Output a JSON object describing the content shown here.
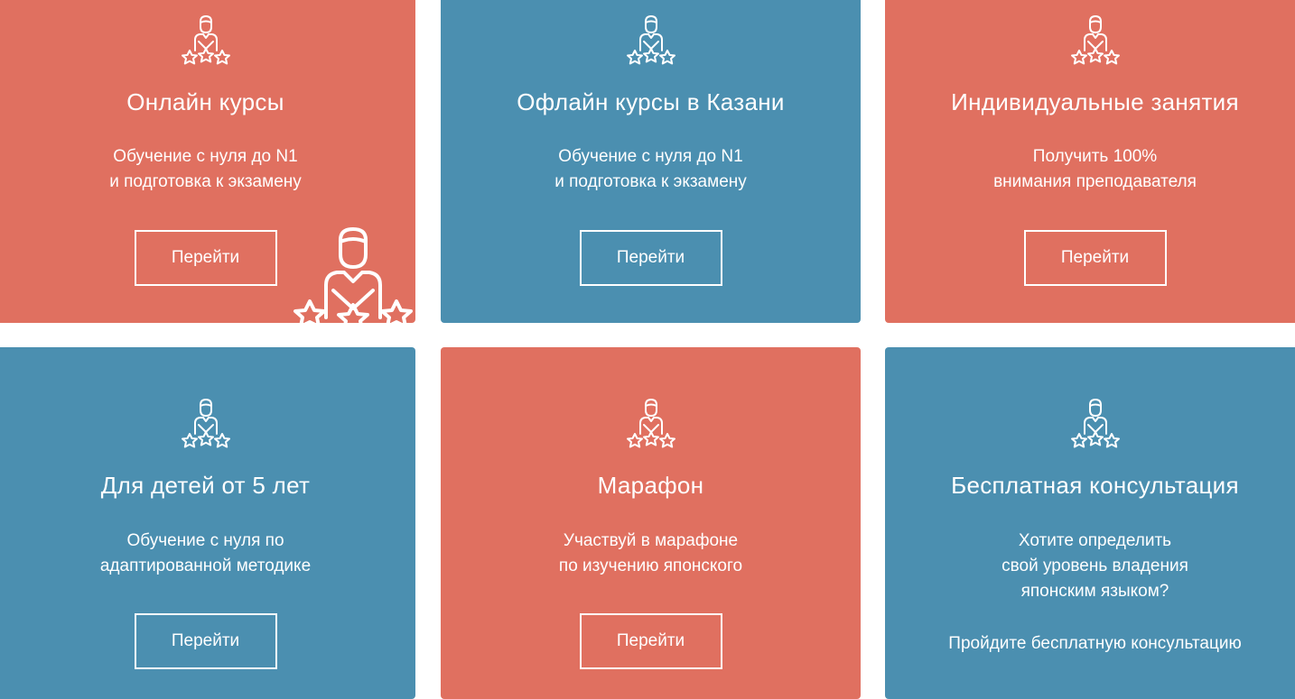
{
  "cards": [
    {
      "title": "Онлайн курсы",
      "desc_line1": "Обучение с нуля до N1",
      "desc_line2": "и подготовка к экзамену",
      "button": "Перейти",
      "color": "#e07060"
    },
    {
      "title": "Офлайн курсы в Казани",
      "desc_line1": "Обучение с нуля до N1",
      "desc_line2": "и подготовка к экзамену",
      "button": "Перейти",
      "color": "#4b8fb0"
    },
    {
      "title": "Индивидуальные занятия",
      "desc_line1": "Получить 100%",
      "desc_line2": "внимания преподавателя",
      "button": "Перейти",
      "color": "#e07060"
    },
    {
      "title": "Для детей от 5 лет",
      "desc_line1": "Обучение с нуля по",
      "desc_line2": "адаптированной методике",
      "button": "Перейти",
      "color": "#4b8fb0"
    },
    {
      "title": "Марафон",
      "desc_line1": "Участвуй в марафоне",
      "desc_line2": "по изучению японского",
      "button": "Перейти",
      "color": "#e07060"
    },
    {
      "title": "Бесплатная консультация",
      "desc_line1": "Хотите определить",
      "desc_line2": "свой уровень владения",
      "desc_line3": "японским языком?",
      "cta": "Пройдите бесплатную консультацию",
      "color": "#4b8fb0"
    }
  ],
  "icons": {
    "card_icon": "person-with-stars-icon",
    "hover_illustration": "person-with-stars-illustration"
  }
}
